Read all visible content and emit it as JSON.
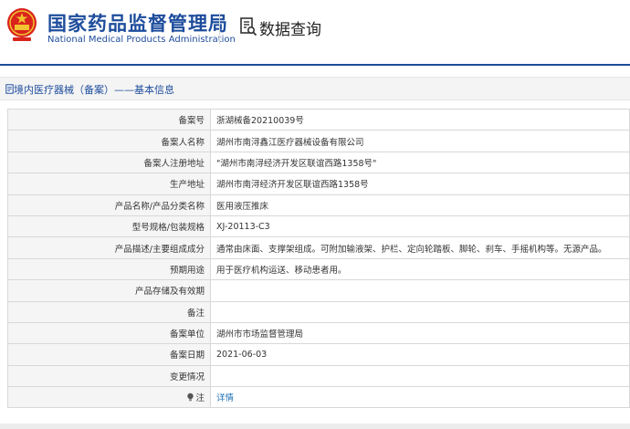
{
  "header": {
    "org_name_cn": "国家药品监督管理局",
    "org_name_en": "National Medical Products Administration",
    "page_title": "数据查询",
    "colors": {
      "brand_blue": "#1d4c9c",
      "emblem_red": "#d9241c",
      "emblem_gold": "#f2c230",
      "link": "#1d6fb8"
    }
  },
  "section": {
    "title": "境内医疗器械（备案）——基本信息",
    "icon": "document-icon"
  },
  "rows": [
    {
      "label": "备案号",
      "value": "浙湖械备20210039号"
    },
    {
      "label": "备案人名称",
      "value": "湖州市南浔鑫江医疗器械设备有限公司"
    },
    {
      "label": "备案人注册地址",
      "value": "\"湖州市南浔经济开发区联谊西路1358号\""
    },
    {
      "label": "生产地址",
      "value": "湖州市南浔经济开发区联谊西路1358号"
    },
    {
      "label": "产品名称/产品分类名称",
      "value": "医用液压推床"
    },
    {
      "label": "型号规格/包装规格",
      "value": "XJ-20113-C3"
    },
    {
      "label": "产品描述/主要组成成分",
      "value": "通常由床面、支撑架组成。可附加输液架、护栏、定向轮踏板、脚轮、刹车、手摇机构等。无源产品。"
    },
    {
      "label": "预期用途",
      "value": "用于医疗机构运送、移动患者用。"
    },
    {
      "label": "产品存储及有效期",
      "value": ""
    },
    {
      "label": "备注",
      "value": ""
    },
    {
      "label": "备案单位",
      "value": "湖州市市场监督管理局"
    },
    {
      "label": "备案日期",
      "value": "2021-06-03"
    },
    {
      "label": "变更情况",
      "value": ""
    },
    {
      "label": "注",
      "value": "详情",
      "icon": "info-bulb-icon"
    }
  ]
}
